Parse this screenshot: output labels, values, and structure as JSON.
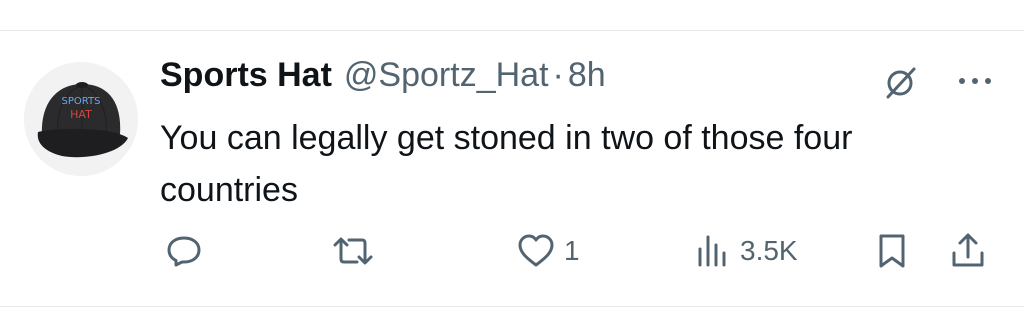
{
  "tweet": {
    "display_name": "Sports Hat",
    "handle": "@Sportz_Hat",
    "separator": "·",
    "time": "8h",
    "text": "You can legally get stoned in two of those four countries"
  },
  "avatar": {
    "cap_line1": "SPORTS",
    "cap_line2": "HAT",
    "line1_color": "#6aa8e8",
    "line2_color": "#d9433b"
  },
  "actions": {
    "reply_icon": "reply-icon",
    "retweet_icon": "retweet-icon",
    "like_icon": "heart-icon",
    "like_count": "1",
    "views_icon": "views-icon",
    "views_count": "3.5K",
    "bookmark_icon": "bookmark-icon",
    "share_icon": "share-icon"
  },
  "colors": {
    "text": "#0f1419",
    "secondary": "#536471",
    "divider": "#e6e9ec"
  }
}
